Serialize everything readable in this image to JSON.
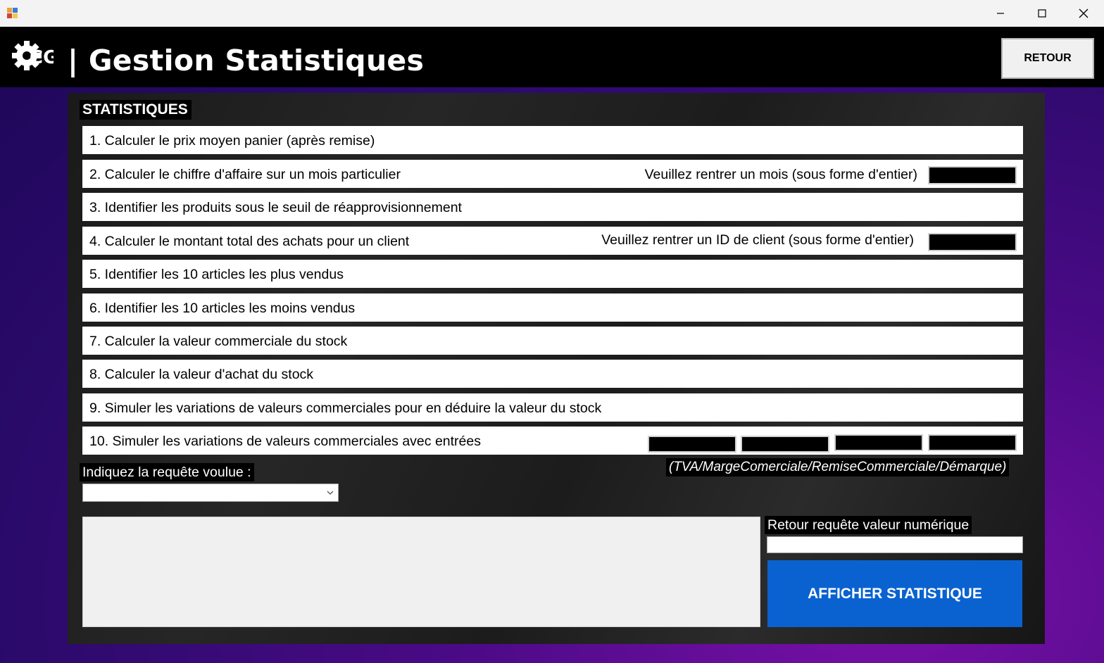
{
  "window": {
    "controls": [
      "minimize",
      "maximize",
      "close"
    ]
  },
  "header": {
    "logo_text": "CG",
    "title": "| Gestion Statistiques",
    "back_label": "RETOUR"
  },
  "panel": {
    "title": "STATISTIQUES",
    "rows": [
      {
        "label": "1. Calculer le prix moyen panier (après remise)"
      },
      {
        "label": "2. Calculer le chiffre d'affaire sur un mois particulier",
        "hint": "Veuillez rentrer un mois (sous forme d'entier)",
        "input_value": ""
      },
      {
        "label": "3. Identifier les produits sous le seuil de réapprovisionnement"
      },
      {
        "label": "4. Calculer le montant total des achats pour un client",
        "hint": "Veuillez rentrer un ID de client (sous forme d'entier)",
        "input_value": ""
      },
      {
        "label": "5. Identifier les 10 articles les plus vendus"
      },
      {
        "label": "6. Identifier les 10 articles les moins vendus"
      },
      {
        "label": "7. Calculer la valeur commerciale du stock"
      },
      {
        "label": "8. Calculer la valeur d'achat du stock"
      },
      {
        "label": "9. Simuler les variations de valeurs commerciales pour en déduire la valeur du stock"
      },
      {
        "label": "10. Simuler les variations de valeurs commerciales avec entrées",
        "inputs": [
          "",
          "",
          "",
          ""
        ]
      }
    ],
    "format_hint": "(TVA/MargeComerciale/RemiseCommerciale/Démarque)",
    "select_label": "Indiquez la requête voulue :",
    "select_value": "",
    "output_text": "",
    "numeric_label": "Retour requête valeur numérique",
    "numeric_value": "",
    "show_label": "AFFICHER STATISTIQUE"
  },
  "colors": {
    "header_bg": "#000000",
    "button_blue": "#0a62d0",
    "bg_purple": "#4a0a86"
  }
}
